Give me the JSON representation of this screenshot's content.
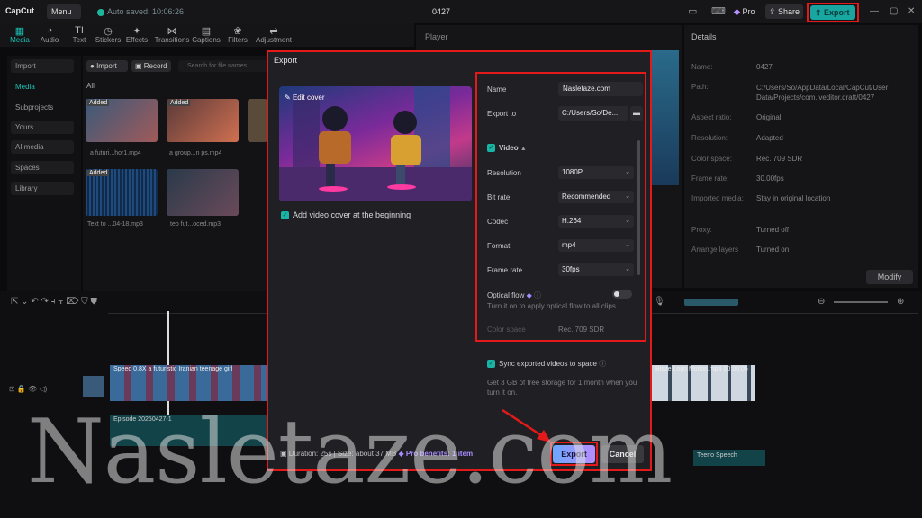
{
  "app": {
    "logo": "CapCut",
    "menu": "Menu",
    "autosave": "Auto saved: 10:06:26",
    "project": "0427",
    "pro": "Pro",
    "share": "Share",
    "export": "Export"
  },
  "tools": [
    "Media",
    "Audio",
    "Text",
    "Stickers",
    "Effects",
    "Transitions",
    "Captions",
    "Filters",
    "Adjustment"
  ],
  "nav": [
    "Import",
    "Media",
    "Subprojects",
    "Yours",
    "AI media",
    "Spaces",
    "Library"
  ],
  "media": {
    "import": "Import",
    "record": "Record",
    "search_placeholder": "Search for file names",
    "all": "All",
    "added": "Added",
    "thumbs": [
      "a futuri...hor1.mp4",
      "a group...n ps.mp4",
      "Text to ...04-18.mp3",
      "teo fut...oced.mp3"
    ]
  },
  "player": {
    "title": "Player"
  },
  "details": {
    "title": "Details",
    "rows": [
      {
        "label": "Name:",
        "value": "0427"
      },
      {
        "label": "Path:",
        "value": "C:/Users/So/AppData/Local/CapCut/User Data/Projects/com.lveditor.draft/0427"
      },
      {
        "label": "Aspect ratio:",
        "value": "Original"
      },
      {
        "label": "Resolution:",
        "value": "Adapted"
      },
      {
        "label": "Color space:",
        "value": "Rec. 709 SDR"
      },
      {
        "label": "Frame rate:",
        "value": "30.00fps"
      },
      {
        "label": "Imported media:",
        "value": "Stay in original location"
      },
      {
        "label": "Proxy:",
        "value": "Turned off"
      },
      {
        "label": "Arrange layers",
        "value": "Turned on"
      }
    ],
    "modify": "Modify"
  },
  "timeline": {
    "clip_label": "Speed 0.8X  a futuristic Iranian teenage girl",
    "clip2": "Blaze Logo Motion.mp4  00:00:05",
    "audio_label": "Episode 20250427-1",
    "audio2": "Teeno Speech"
  },
  "dialog": {
    "title": "Export",
    "edit_cover": "Edit cover",
    "add_cover": "Add video cover at the beginning",
    "name_label": "Name",
    "name_value": "Nasletaze.com",
    "export_to_label": "Export to",
    "export_to_value": "C:/Users/So/De...",
    "video_label": "Video",
    "settings": [
      {
        "label": "Resolution",
        "value": "1080P"
      },
      {
        "label": "Bit rate",
        "value": "Recommended"
      },
      {
        "label": "Codec",
        "value": "H.264"
      },
      {
        "label": "Format",
        "value": "mp4"
      },
      {
        "label": "Frame rate",
        "value": "30fps"
      }
    ],
    "optical_flow": "Optical flow",
    "optical_hint": "Turn it on to apply optical flow to all clips.",
    "color_space_label": "Color space",
    "color_space_value": "Rec. 709 SDR",
    "sync": "Sync exported videos to space",
    "storage": "Get 3 GB of free storage for 1 month when you turn it on.",
    "footer": "Duration: 25s | Size: about 37 MB",
    "pro_benefits": "Pro benefits: 1 item",
    "export_btn": "Export",
    "cancel_btn": "Cancel"
  },
  "watermark": "Nasletaze.com"
}
